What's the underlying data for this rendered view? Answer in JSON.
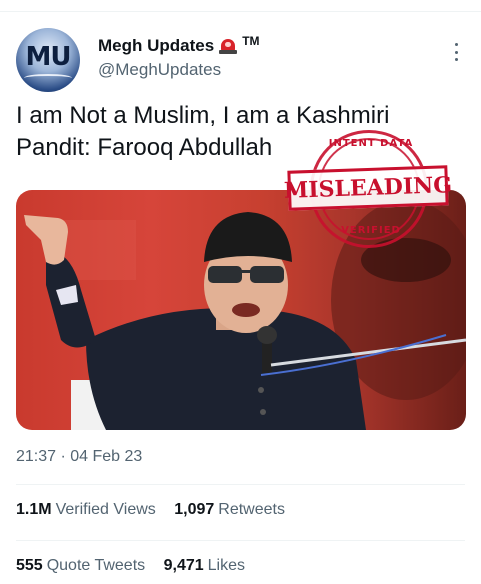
{
  "account": {
    "avatar_text": "MU",
    "display_name": "Megh Updates",
    "badge_icon": "siren-icon",
    "trademark": "TM",
    "handle": "@MeghUpdates"
  },
  "tweet": {
    "text": "I am Not a Muslim, I am a Kashmiri Pandit: Farooq Abdullah",
    "timestamp": "21:37 · 04 Feb 23"
  },
  "stamp": {
    "arc_top": "INTENT DATA",
    "label": "MISLEADING",
    "arc_bottom": "VERIFIED",
    "color": "#c8102e"
  },
  "stats": {
    "views": {
      "value": "1.1M",
      "label": "Verified Views"
    },
    "retweets": {
      "value": "1,097",
      "label": "Retweets"
    },
    "quote_tweets": {
      "value": "555",
      "label": "Quote Tweets"
    },
    "likes": {
      "value": "9,471",
      "label": "Likes"
    }
  },
  "colors": {
    "text_primary": "#0f1419",
    "text_secondary": "#536471",
    "divider": "#eff3f4"
  }
}
